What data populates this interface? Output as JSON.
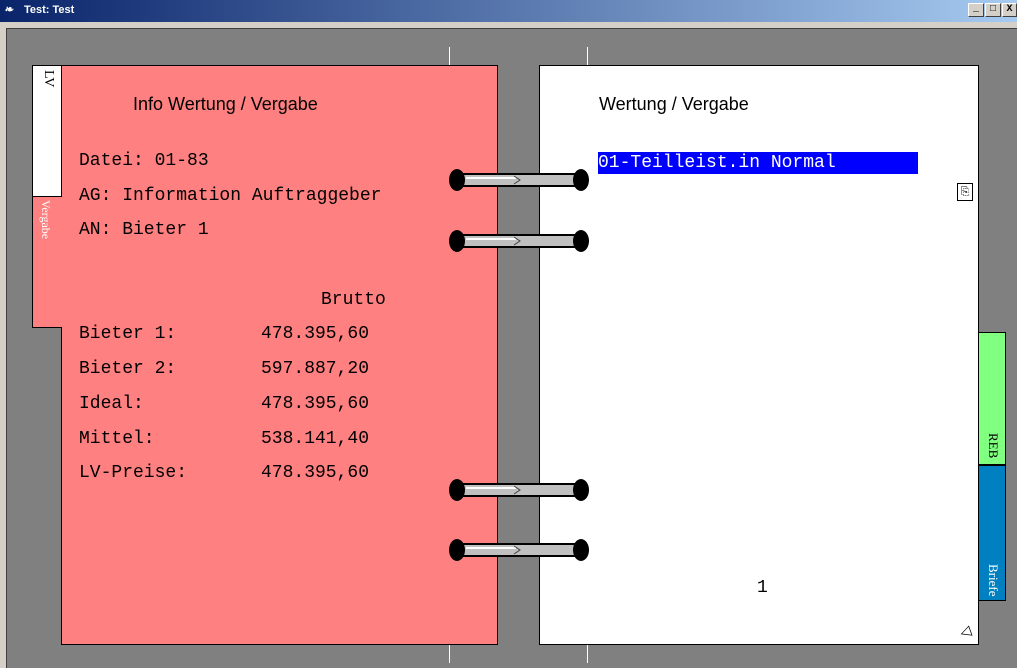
{
  "window": {
    "title": "Test: Test",
    "icon": "app-book-icon",
    "controls": {
      "minimize": "_",
      "maximize": "□",
      "close": "X"
    }
  },
  "left_page": {
    "tab_lv": "LV",
    "tab_vergabe": "Vergabe",
    "title": "Info Wertung / Vergabe",
    "datei": "Datei: 01-83",
    "ag": "AG: Information Auftraggeber",
    "an": "AN: Bieter 1",
    "column_header": "Brutto",
    "rows": [
      {
        "label": "Bieter 1:",
        "value": "478.395,60"
      },
      {
        "label": "Bieter 2:",
        "value": "597.887,20"
      },
      {
        "label": "Ideal:",
        "value": "478.395,60"
      },
      {
        "label": "Mittel:",
        "value": "538.141,40"
      },
      {
        "label": "LV-Preise:",
        "value": "478.395,60"
      }
    ]
  },
  "right_page": {
    "title": "Wertung / Vergabe",
    "selected_item": "01-Teilleist.in Normal",
    "page_number": "1",
    "tab_reb": "REB",
    "tab_briefe": "Briefe"
  },
  "colors": {
    "left_page": "#ff8080",
    "right_page": "#ffffff",
    "reb_tab": "#80ff80",
    "briefe_tab": "#0080c0",
    "selection": "#0000ff",
    "titlebar": "#0a246a"
  }
}
